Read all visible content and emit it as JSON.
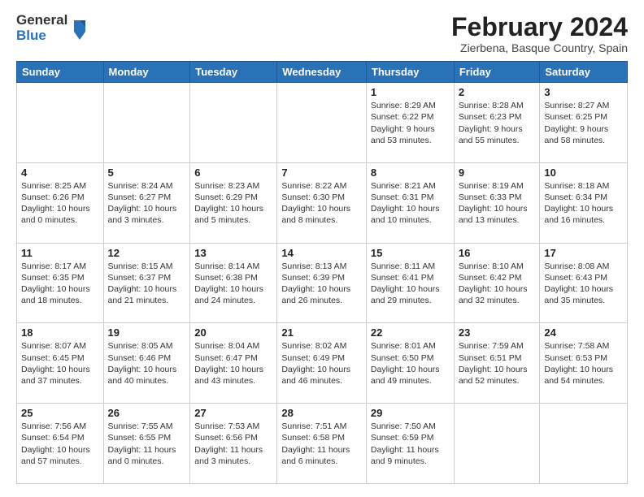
{
  "logo": {
    "general": "General",
    "blue": "Blue"
  },
  "header": {
    "month": "February 2024",
    "location": "Zierbena, Basque Country, Spain"
  },
  "weekdays": [
    "Sunday",
    "Monday",
    "Tuesday",
    "Wednesday",
    "Thursday",
    "Friday",
    "Saturday"
  ],
  "weeks": [
    [
      {
        "day": "",
        "info": ""
      },
      {
        "day": "",
        "info": ""
      },
      {
        "day": "",
        "info": ""
      },
      {
        "day": "",
        "info": ""
      },
      {
        "day": "1",
        "info": "Sunrise: 8:29 AM\nSunset: 6:22 PM\nDaylight: 9 hours\nand 53 minutes."
      },
      {
        "day": "2",
        "info": "Sunrise: 8:28 AM\nSunset: 6:23 PM\nDaylight: 9 hours\nand 55 minutes."
      },
      {
        "day": "3",
        "info": "Sunrise: 8:27 AM\nSunset: 6:25 PM\nDaylight: 9 hours\nand 58 minutes."
      }
    ],
    [
      {
        "day": "4",
        "info": "Sunrise: 8:25 AM\nSunset: 6:26 PM\nDaylight: 10 hours\nand 0 minutes."
      },
      {
        "day": "5",
        "info": "Sunrise: 8:24 AM\nSunset: 6:27 PM\nDaylight: 10 hours\nand 3 minutes."
      },
      {
        "day": "6",
        "info": "Sunrise: 8:23 AM\nSunset: 6:29 PM\nDaylight: 10 hours\nand 5 minutes."
      },
      {
        "day": "7",
        "info": "Sunrise: 8:22 AM\nSunset: 6:30 PM\nDaylight: 10 hours\nand 8 minutes."
      },
      {
        "day": "8",
        "info": "Sunrise: 8:21 AM\nSunset: 6:31 PM\nDaylight: 10 hours\nand 10 minutes."
      },
      {
        "day": "9",
        "info": "Sunrise: 8:19 AM\nSunset: 6:33 PM\nDaylight: 10 hours\nand 13 minutes."
      },
      {
        "day": "10",
        "info": "Sunrise: 8:18 AM\nSunset: 6:34 PM\nDaylight: 10 hours\nand 16 minutes."
      }
    ],
    [
      {
        "day": "11",
        "info": "Sunrise: 8:17 AM\nSunset: 6:35 PM\nDaylight: 10 hours\nand 18 minutes."
      },
      {
        "day": "12",
        "info": "Sunrise: 8:15 AM\nSunset: 6:37 PM\nDaylight: 10 hours\nand 21 minutes."
      },
      {
        "day": "13",
        "info": "Sunrise: 8:14 AM\nSunset: 6:38 PM\nDaylight: 10 hours\nand 24 minutes."
      },
      {
        "day": "14",
        "info": "Sunrise: 8:13 AM\nSunset: 6:39 PM\nDaylight: 10 hours\nand 26 minutes."
      },
      {
        "day": "15",
        "info": "Sunrise: 8:11 AM\nSunset: 6:41 PM\nDaylight: 10 hours\nand 29 minutes."
      },
      {
        "day": "16",
        "info": "Sunrise: 8:10 AM\nSunset: 6:42 PM\nDaylight: 10 hours\nand 32 minutes."
      },
      {
        "day": "17",
        "info": "Sunrise: 8:08 AM\nSunset: 6:43 PM\nDaylight: 10 hours\nand 35 minutes."
      }
    ],
    [
      {
        "day": "18",
        "info": "Sunrise: 8:07 AM\nSunset: 6:45 PM\nDaylight: 10 hours\nand 37 minutes."
      },
      {
        "day": "19",
        "info": "Sunrise: 8:05 AM\nSunset: 6:46 PM\nDaylight: 10 hours\nand 40 minutes."
      },
      {
        "day": "20",
        "info": "Sunrise: 8:04 AM\nSunset: 6:47 PM\nDaylight: 10 hours\nand 43 minutes."
      },
      {
        "day": "21",
        "info": "Sunrise: 8:02 AM\nSunset: 6:49 PM\nDaylight: 10 hours\nand 46 minutes."
      },
      {
        "day": "22",
        "info": "Sunrise: 8:01 AM\nSunset: 6:50 PM\nDaylight: 10 hours\nand 49 minutes."
      },
      {
        "day": "23",
        "info": "Sunrise: 7:59 AM\nSunset: 6:51 PM\nDaylight: 10 hours\nand 52 minutes."
      },
      {
        "day": "24",
        "info": "Sunrise: 7:58 AM\nSunset: 6:53 PM\nDaylight: 10 hours\nand 54 minutes."
      }
    ],
    [
      {
        "day": "25",
        "info": "Sunrise: 7:56 AM\nSunset: 6:54 PM\nDaylight: 10 hours\nand 57 minutes."
      },
      {
        "day": "26",
        "info": "Sunrise: 7:55 AM\nSunset: 6:55 PM\nDaylight: 11 hours\nand 0 minutes."
      },
      {
        "day": "27",
        "info": "Sunrise: 7:53 AM\nSunset: 6:56 PM\nDaylight: 11 hours\nand 3 minutes."
      },
      {
        "day": "28",
        "info": "Sunrise: 7:51 AM\nSunset: 6:58 PM\nDaylight: 11 hours\nand 6 minutes."
      },
      {
        "day": "29",
        "info": "Sunrise: 7:50 AM\nSunset: 6:59 PM\nDaylight: 11 hours\nand 9 minutes."
      },
      {
        "day": "",
        "info": ""
      },
      {
        "day": "",
        "info": ""
      }
    ]
  ]
}
